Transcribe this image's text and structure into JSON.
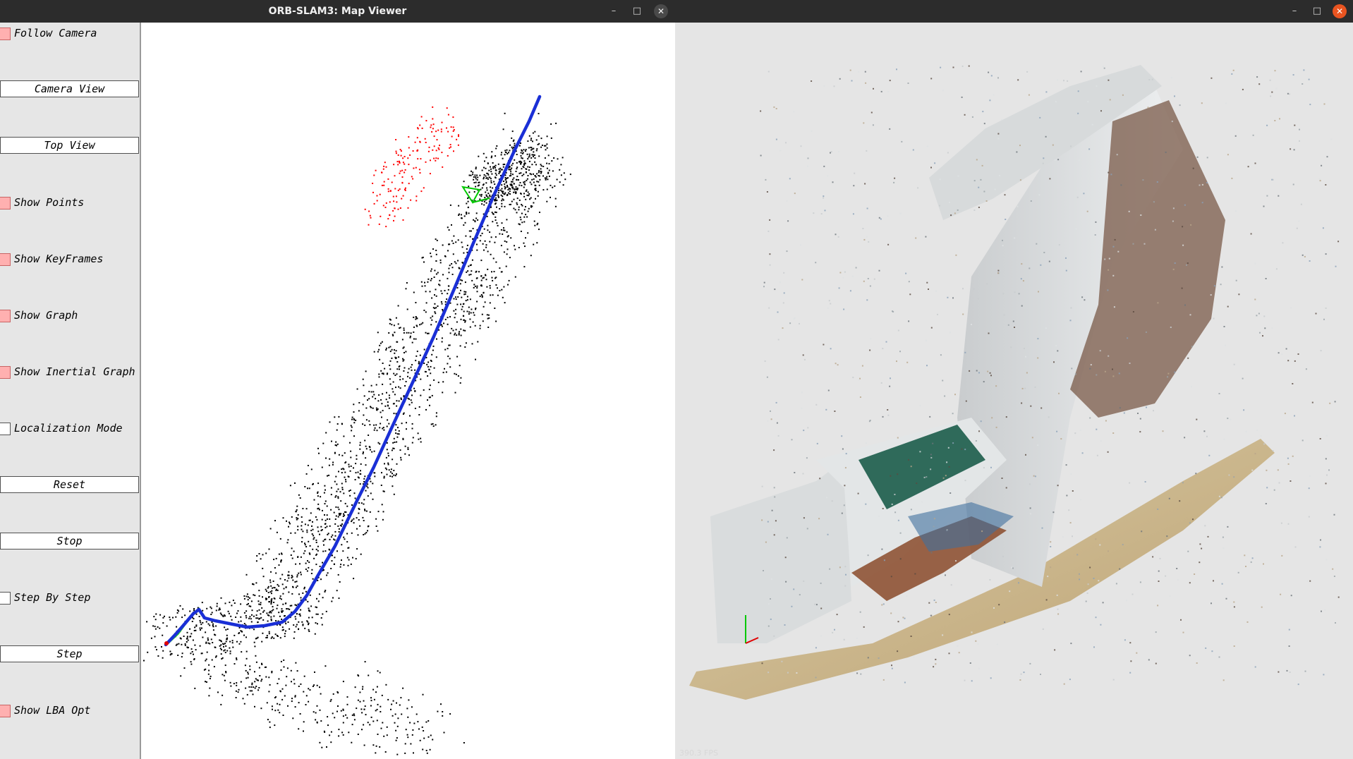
{
  "left_window": {
    "title": "ORB-SLAM3: Map Viewer",
    "controls": {
      "minimize": "–",
      "maximize": "□",
      "close": "✕"
    }
  },
  "right_window": {
    "controls": {
      "minimize": "–",
      "maximize": "□",
      "close": "✕"
    },
    "fps": "390.3 FPS"
  },
  "panel": {
    "follow_camera": {
      "label": "Follow Camera",
      "checked": true
    },
    "camera_view": "Camera View",
    "top_view": "Top View",
    "show_points": {
      "label": "Show Points",
      "checked": true
    },
    "show_keyframes": {
      "label": "Show KeyFrames",
      "checked": true
    },
    "show_graph": {
      "label": "Show Graph",
      "checked": true
    },
    "show_inertial_graph": {
      "label": "Show Inertial Graph",
      "checked": true
    },
    "localization_mode": {
      "label": "Localization Mode",
      "checked": false
    },
    "reset": "Reset",
    "stop": "Stop",
    "step_by_step": {
      "label": "Step By Step",
      "checked": false
    },
    "step": "Step",
    "show_lba_opt": {
      "label": "Show LBA Opt",
      "checked": true
    }
  },
  "colors": {
    "checkbox_on": "#ffb0b0",
    "map_points": "#000000",
    "local_points": "#ff0000",
    "trajectory": "#1a2fd6",
    "graph_edges": "#1fd11f",
    "current_camera": "#00c800"
  },
  "icons": {
    "checkbox": "square-checkbox",
    "camera": "camera-frustum-icon",
    "axes": "coordinate-axes-icon"
  }
}
